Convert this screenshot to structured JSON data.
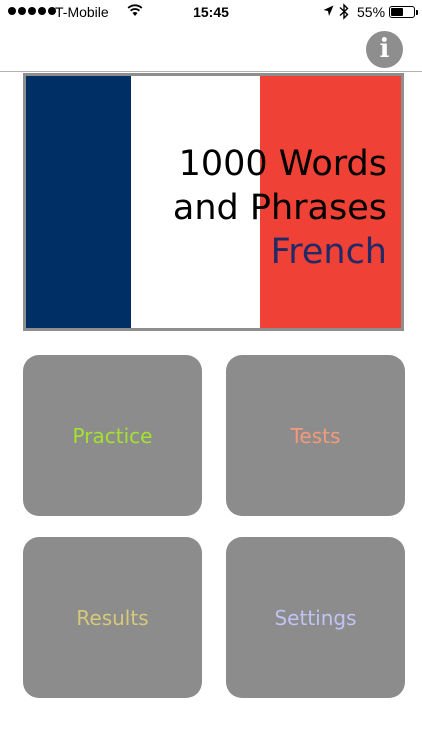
{
  "status_bar": {
    "carrier": "T-Mobile",
    "time": "15:45",
    "battery_percent": "55%",
    "battery_level": 0.55,
    "icons": [
      "signal-dots-icon",
      "wifi-icon",
      "location-arrow-icon",
      "bluetooth-icon",
      "battery-icon"
    ]
  },
  "nav": {
    "info_glyph": "i"
  },
  "banner": {
    "title_line1": "1000 Words",
    "title_line2": "and Phrases",
    "language": "French",
    "colors": {
      "blue": "#002f65",
      "white": "#ffffff",
      "red": "#ef4135",
      "frame": "#8e8e8e",
      "language_text": "#1f2a66"
    }
  },
  "menu": {
    "practice_label": "Practice",
    "tests_label": "Tests",
    "results_label": "Results",
    "settings_label": "Settings",
    "colors": {
      "tile_bg": "#8c8c8c",
      "practice": "#a4e32c",
      "tests": "#f49a7a",
      "results": "#d6c97a",
      "settings": "#c0c3f3"
    }
  }
}
